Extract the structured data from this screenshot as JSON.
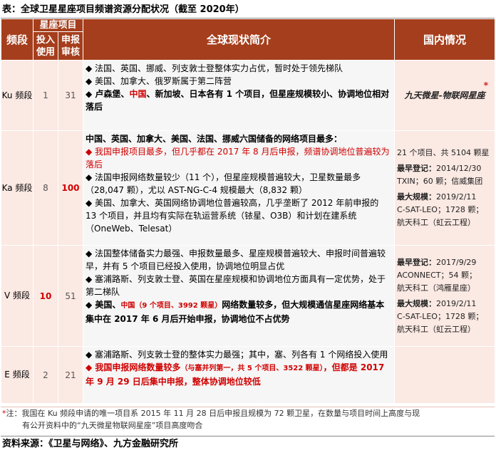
{
  "title": "表：全球卫星星座项目频谱资源分配状况（截至 2020年）",
  "header": {
    "band": "频段",
    "projects": "星座项目",
    "in_use": "投入使用",
    "filed": "申报审核",
    "global": "全球现状简介",
    "domestic": "国内情况"
  },
  "rows": [
    {
      "band": "Ku 频段",
      "in_use": "1",
      "filed": "31",
      "items": [
        "◆ 法国、英国、挪威、列支敦士登整体实力占优，暂时处于领先梯队",
        "◆ 美国、加拿大、俄罗斯属于第二阵营",
        "◆ 卢森堡、",
        "中国",
        "、新加坡、日本各有 1 个项目，但星座规模较小、协调地位相对落后"
      ],
      "domestic": "九天微星-物联网星座",
      "star": "*"
    },
    {
      "band": "Ka 频段",
      "in_use": "8",
      "filed": "100",
      "items": [
        "中国、英国、加拿大、美国、法国、挪威六国储备的网络项目最多：",
        "◆ 我国申报项目最多，但几乎都在 2017 年 8 月后申报，频谱协调地位普遍较为落后",
        "◆ 法国申报网络数量较少（11 个），但星座规模普遍较大，卫星数量最多（28,047 颗），尤以 AST-NG-C-4 规模最大（8,832 颗）",
        "◆ 美国、加拿大、英国网络协调地位普遍较高，几乎垄断了 2012 年前申报的 13 个项目，并且均有实际在轨运营系统（铱星、O3B）和计划在建系统（OneWeb、Telesat）"
      ],
      "domestic": {
        "line1": "21 个项目、共 5104 颗星",
        "early_label": "最早登记：",
        "early_date": "2014/12/30",
        "early_detail": "TXIN；60 颗；信威集团",
        "max_label": "最大规模：",
        "max_date": "2019/2/11",
        "max_detail1": "C-SAT-LEO；1728 颗；",
        "max_detail2": "航天科工（虹云工程）"
      }
    },
    {
      "band": "V 频段",
      "in_use": "10",
      "filed": "51",
      "items": [
        "◆ 法国整体储备实力最强、申报数量最多、星座规模普遍较大、申报时间普遍较早，并有 5 个项目已经投入使用，协调地位明显占优",
        "◆ 塞浦路斯、列支敦士登、英国在星座规模和协调地位方面具有一定优势，处于第二梯队",
        "◆ 美国、",
        "中国（9 个项目、3992 颗星）",
        "网络数量较多，但大规模通信星座网络基本集中在 2017 年 6 月后开始申报，协调地位不占优势"
      ],
      "domestic": {
        "early_label": "最早登记：",
        "early_date": "2017/9/29",
        "early_detail1": "ACONNECT；54 颗；",
        "early_detail2": "航天科工（鸿雁星座）",
        "max_label": "最大规模：",
        "max_date": "2019/2/11",
        "max_detail1": "C-SAT-LEO；1728 颗；",
        "max_detail2": "航天科工（虹云工程）"
      }
    },
    {
      "band": "E 频段",
      "in_use": "2",
      "filed": "21",
      "items": [
        "◆ 塞浦路斯、列支敦士登的整体实力最强；其中，塞、列各有 1 个网络投入使用",
        "◆ 我国申报网络数量较多",
        "（与塞并列第一，共 5 个项目、3522 颗星）",
        "，但都是 2017 年 9 月 29 日后集中申报，整体协调地位较低"
      ]
    }
  ],
  "note": {
    "star": "*",
    "line1": "注：我国在 Ku 频段申请的唯一项目系 2015 年 11 月 28 日后申报且规模为 72 颗卫星，在数量与项目时间上高度与现",
    "line2": "有公开资料中的“九天微星物联网星座”项目高度吻合"
  },
  "source": "资料来源：《卫星与网络》、九方金融研究所",
  "colors": {
    "header_bg": "#a53e1c",
    "light_bg": "#fbe9e3",
    "desc_bg": "#f6f6f6",
    "accent_red": "#d00000"
  }
}
